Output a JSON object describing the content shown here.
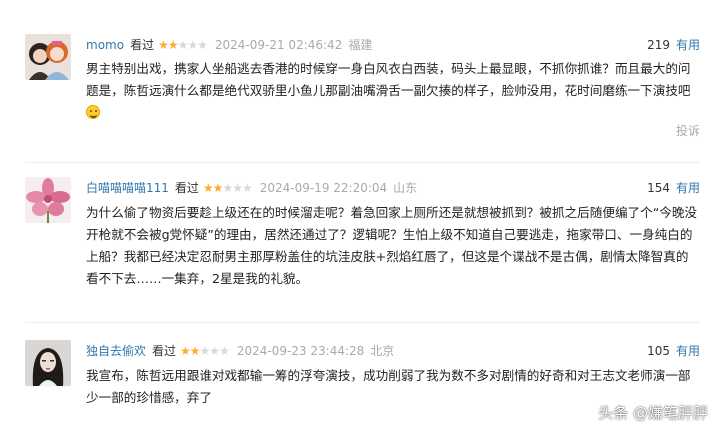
{
  "reviews": [
    {
      "username": "momo",
      "watched": "看过",
      "rating": 2,
      "stars_total": 5,
      "date": "2024-09-21 02:46:42",
      "location": "福建",
      "votes": "219",
      "useful_label": "有用",
      "text": "男主特别出戏，携家人坐船逃去香港的时候穿一身白风衣白西装，码头上最显眼，不抓你抓谁？而且最大的问题是，陈哲远演什么都是绝代双骄里小鱼儿那副油嘴滑舌一副欠揍的样子，脸帅没用，花时间磨练一下演技吧",
      "report_label": "投诉"
    },
    {
      "username": "白喵喵喵喵111",
      "watched": "看过",
      "rating": 2,
      "stars_total": 5,
      "date": "2024-09-19 22:20:04",
      "location": "山东",
      "votes": "154",
      "useful_label": "有用",
      "text": "为什么偷了物资后要趁上级还在的时候溜走呢？着急回家上厕所还是就想被抓到？被抓之后随便编了个“今晚没开枪就不会被g党怀疑”的理由，居然还通过了？逻辑呢？生怕上级不知道自己要逃走，拖家带口、一身纯白的上船？我都已经决定忍耐男主那厚粉盖住的坑洼皮肤+烈焰红唇了，但这是个谍战不是古偶，剧情太降智真的看不下去……一集弃，2星是我的礼貌。"
    },
    {
      "username": "独自去偷欢",
      "watched": "看过",
      "rating": 2,
      "stars_total": 5,
      "date": "2024-09-23 23:44:28",
      "location": "北京",
      "votes": "105",
      "useful_label": "有用",
      "text": "我宣布，陈哲远用跟谁对戏都输一筹的浮夸演技，成功削弱了我为数不多对剧情的好奇和对王志文老师演一部少一部的珍惜感，弃了"
    }
  ],
  "watermark": "头条 @嫌笔胖胖",
  "colors": {
    "link": "#3377aa",
    "star": "#ffac2d",
    "muted": "#aaaaaa"
  }
}
